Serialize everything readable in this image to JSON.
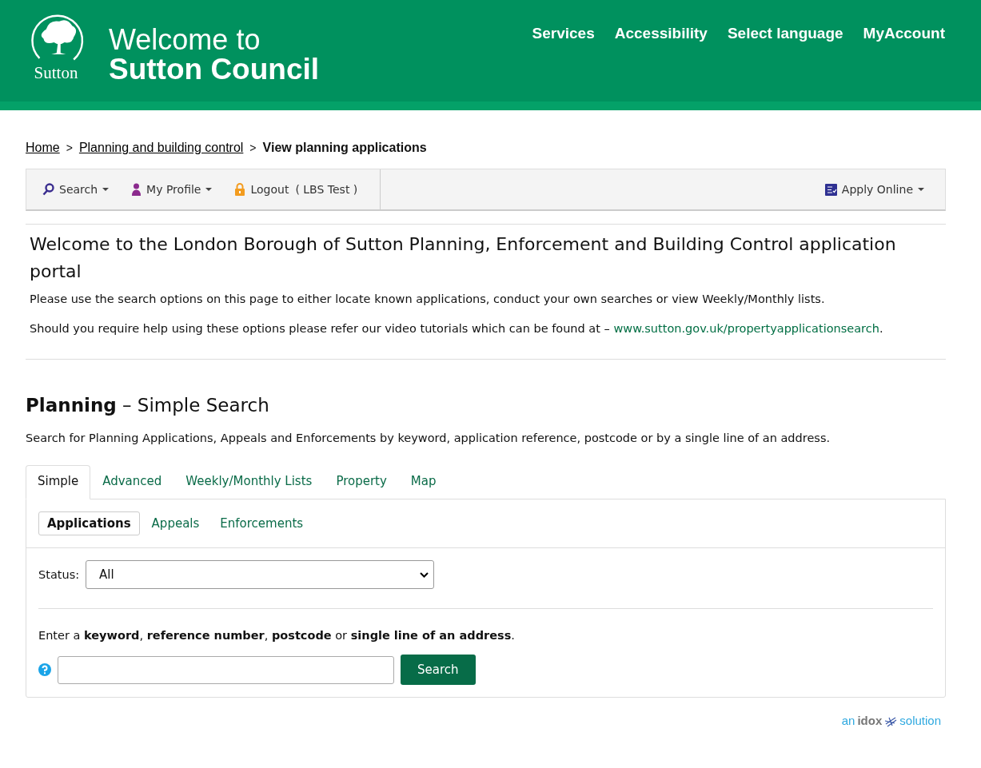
{
  "header": {
    "logo_text": "Sutton",
    "title_line1": "Welcome to",
    "title_line2": "Sutton Council",
    "nav": [
      "Services",
      "Accessibility",
      "Select language",
      "MyAccount"
    ]
  },
  "breadcrumb": [
    {
      "label": "Home",
      "kind": "link"
    },
    {
      "separator": ">",
      "label": "Planning and building control",
      "kind": "link"
    },
    {
      "separator": ">",
      "label": "View planning applications",
      "kind": "current"
    }
  ],
  "toolbar": {
    "left": [
      {
        "label": "Search",
        "kind": "search",
        "dropdown": true
      },
      {
        "label": "My Profile",
        "kind": "profile",
        "dropdown": true
      },
      {
        "label": "Logout",
        "kind": "logout",
        "dropdown": false,
        "user": "( LBS Test )"
      }
    ],
    "right": [
      {
        "label": "Apply Online",
        "kind": "apply",
        "dropdown": true
      }
    ]
  },
  "intro": {
    "heading": "Welcome to the London Borough of Sutton Planning, Enforcement and Building Control application portal",
    "text": "Please use the search options on this page to either locate known applications, conduct your own searches or view Weekly/Monthly lists.",
    "help_text": "Should you require help using these options please refer our video tutorials which can be found at – ",
    "help_link": "www.sutton.gov.uk/propertyapplicationsearch",
    "help_suffix": "."
  },
  "search": {
    "heading": "**Planning** – Simple Search",
    "description": "Search for Planning Applications, Appeals and Enforcements by keyword, application reference, postcode or by a single line of an address.",
    "tabs": [
      {
        "label": "Simple",
        "selected": true
      },
      {
        "label": "Advanced",
        "selected": false
      },
      {
        "label": "Weekly/Monthly Lists",
        "selected": false
      },
      {
        "label": "Property",
        "selected": false
      },
      {
        "label": "Map",
        "selected": false
      }
    ],
    "subtabs": [
      {
        "label": "Applications",
        "selected": true
      },
      {
        "label": "Appeals",
        "selected": false
      },
      {
        "label": "Enforcements",
        "selected": false
      }
    ],
    "status_label": "Status:",
    "status_value": "All",
    "instruction": "Enter a **keyword**, **reference number**, **postcode** or **single line of an address**.",
    "button": "Search"
  },
  "footer": {
    "prefix": "an",
    "brand": "idox",
    "suffix": "solution"
  }
}
